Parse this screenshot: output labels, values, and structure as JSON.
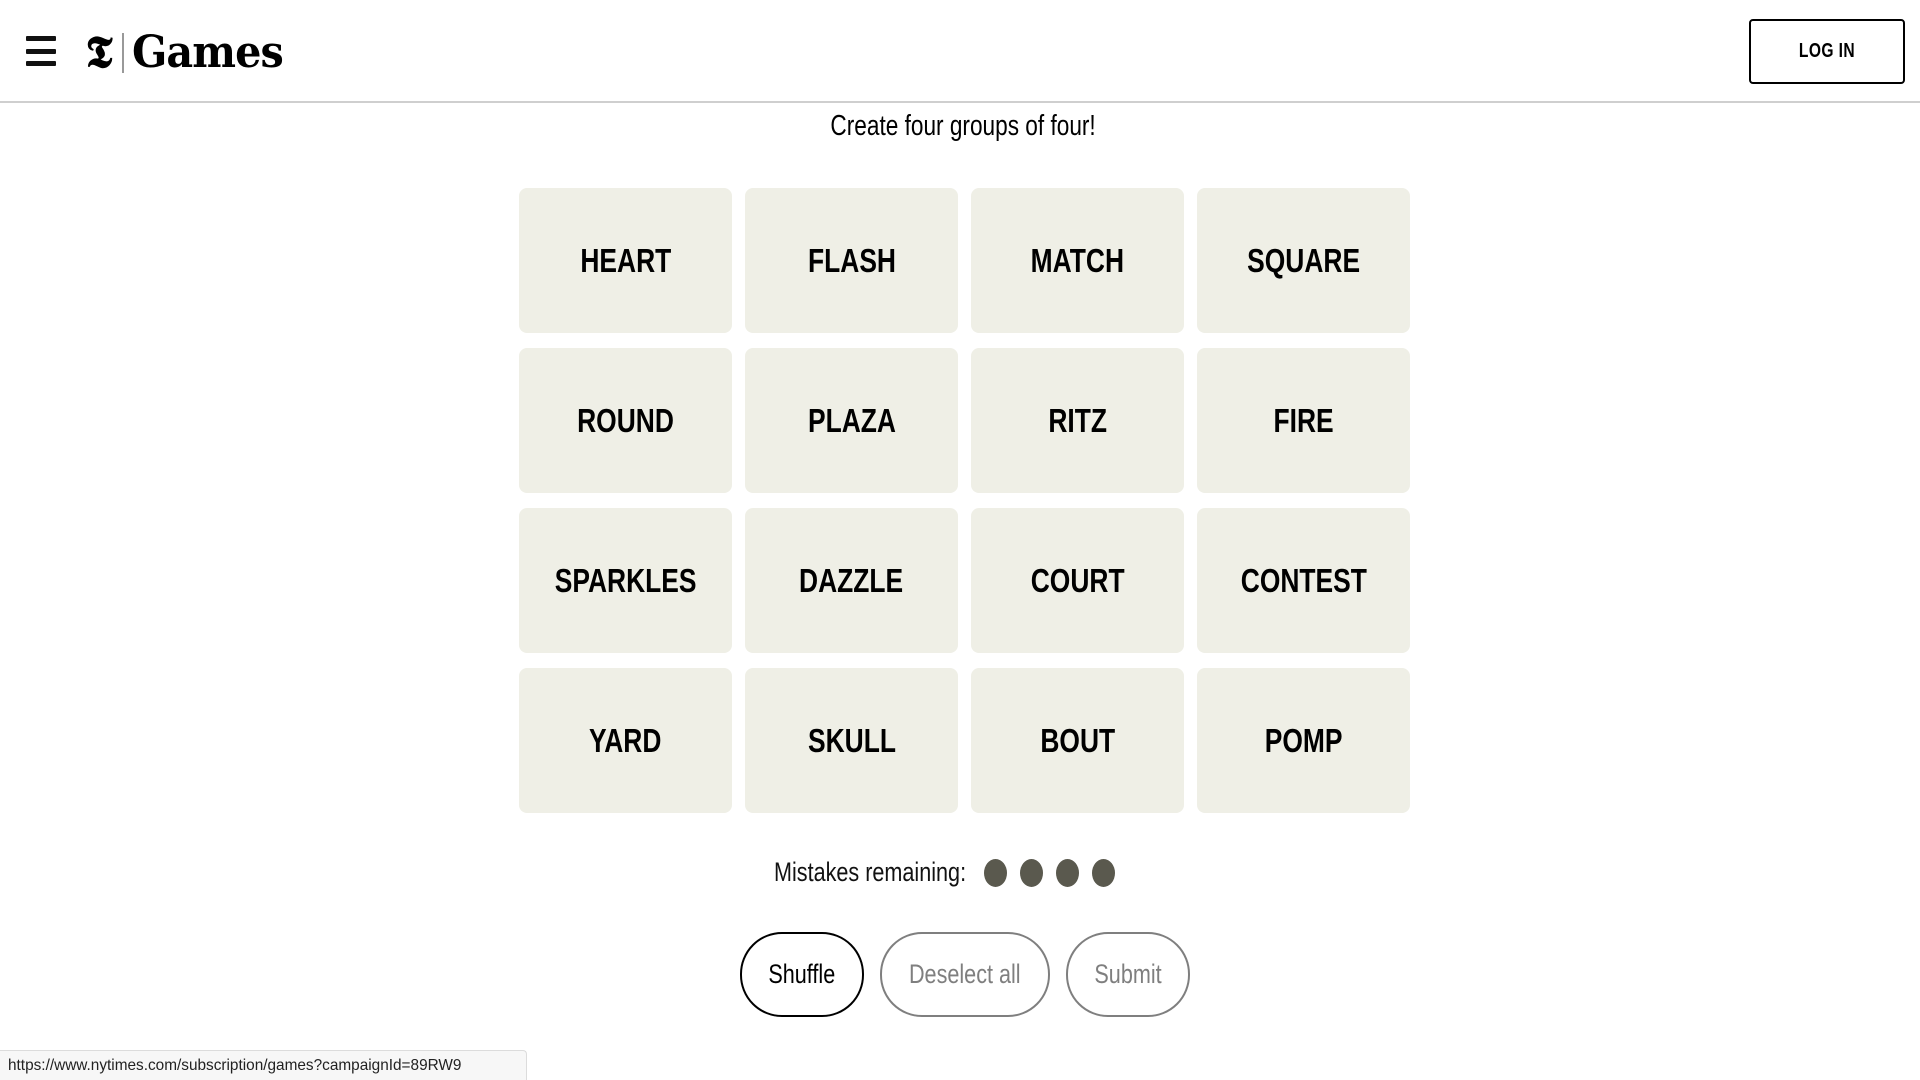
{
  "header": {
    "menu_icon": "hamburger-menu-icon",
    "logo_mark": "𝕿",
    "logo_text": "Games",
    "login_label": "LOG IN"
  },
  "game": {
    "subtitle": "Create four groups of four!",
    "tiles": [
      "HEART",
      "FLASH",
      "MATCH",
      "SQUARE",
      "ROUND",
      "PLAZA",
      "RITZ",
      "FIRE",
      "SPARKLES",
      "DAZZLE",
      "COURT",
      "CONTEST",
      "YARD",
      "SKULL",
      "BOUT",
      "POMP"
    ],
    "mistakes_label": "Mistakes remaining:",
    "mistakes_remaining": 4,
    "buttons": {
      "shuffle": "Shuffle",
      "deselect": "Deselect all",
      "submit": "Submit"
    }
  },
  "colors": {
    "tile_bg": "#efefe6",
    "dot": "#5a594e",
    "disabled_button": "#7f7f7f"
  },
  "statusbar": {
    "url": "https://www.nytimes.com/subscription/games?campaignId=89RW9"
  }
}
